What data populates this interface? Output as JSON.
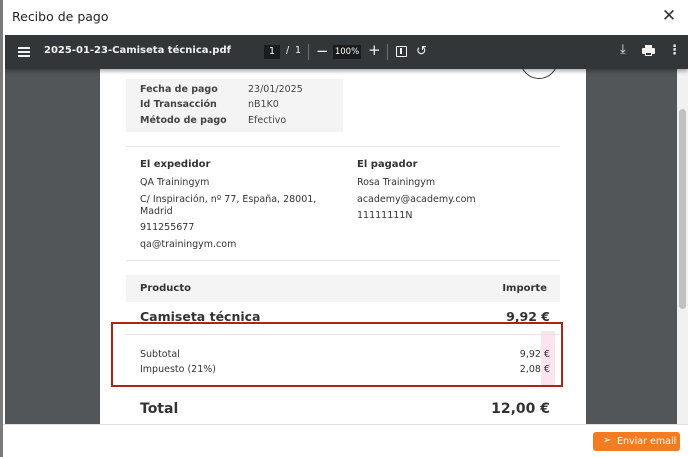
{
  "modal": {
    "title": "Recibo de pago",
    "close_glyph": "✕"
  },
  "toolbar": {
    "menu_icon": "hamburger-menu-icon",
    "filename": "2025-01-23-Camiseta técnica.pdf",
    "page_current": "1",
    "page_separator": "/",
    "page_total": "1",
    "zoom_out_glyph": "−",
    "zoom": "100%",
    "zoom_in_glyph": "+",
    "rotate_glyph": "↺",
    "download_glyph": "⤓",
    "more_glyph": "⋮"
  },
  "receipt": {
    "info": [
      {
        "label": "Fecha de pago",
        "value": "23/01/2025"
      },
      {
        "label": "Id Transacción",
        "value": "nB1K0"
      },
      {
        "label": "Método de pago",
        "value": "Efectivo"
      }
    ],
    "sender": {
      "heading": "El expedidor",
      "name": "QA Trainingym",
      "address_1": "C/ Inspiración, nº 77, España, 28001,",
      "address_2": "Madrid",
      "phone": "911255677",
      "email": "qa@trainingym.com"
    },
    "payer": {
      "heading": "El pagador",
      "name": "Rosa Trainingym",
      "email": "academy@academy.com",
      "id": "11111111N"
    },
    "table": {
      "col_product": "Producto",
      "col_amount": "Importe",
      "item_name": "Camiseta técnica",
      "item_amount": "9,92 €"
    },
    "summary": {
      "subtotal_label": "Subtotal",
      "subtotal_value": "9,92 €",
      "tax_label": "Impuesto (21%)",
      "tax_value": "2,08 €"
    },
    "total": {
      "label": "Total",
      "value": "12,00 €"
    }
  },
  "footer": {
    "send_icon": "paper-plane-icon",
    "send_glyph": "➢",
    "send_label": "Enviar email"
  },
  "colors": {
    "accent": "#f47c20",
    "highlight": "#a5271c",
    "toolbar_bg": "#323639"
  }
}
